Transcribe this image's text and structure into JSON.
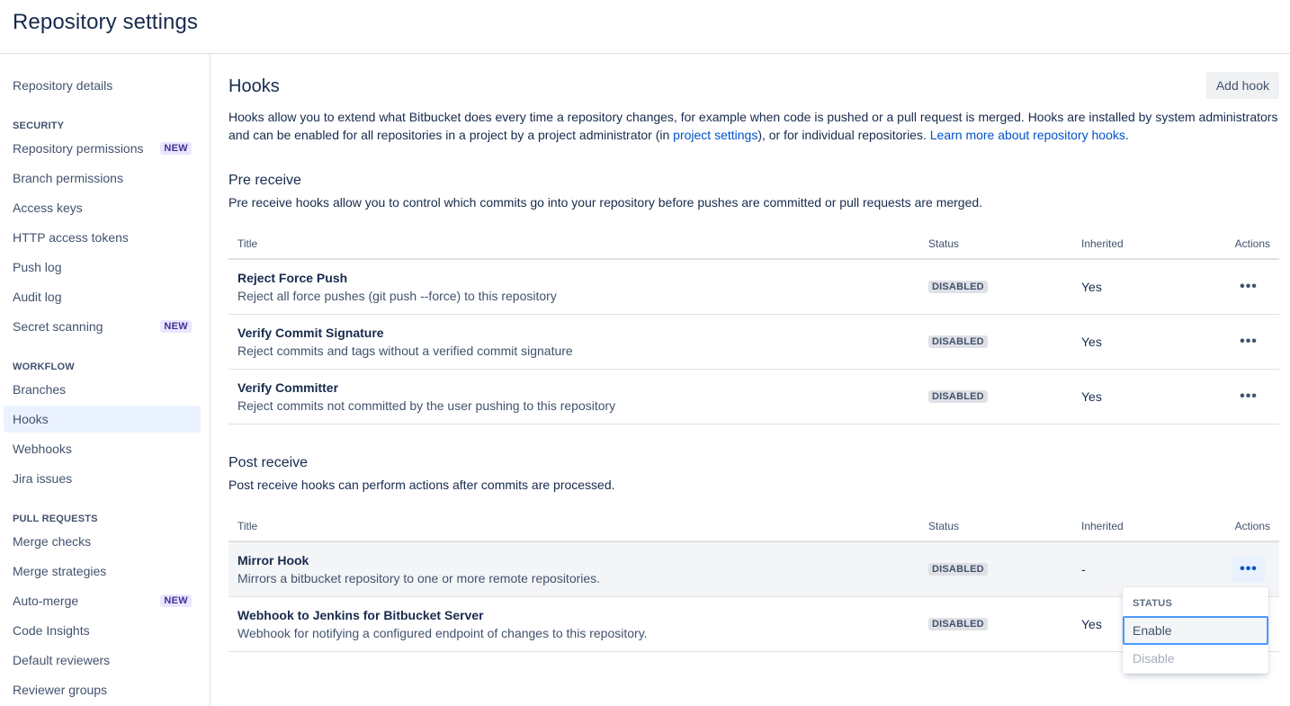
{
  "page": {
    "title": "Repository settings"
  },
  "sidebar": {
    "items": [
      {
        "label": "Repository details"
      },
      {
        "section": "SECURITY"
      },
      {
        "label": "Repository permissions",
        "badge": "NEW"
      },
      {
        "label": "Branch permissions"
      },
      {
        "label": "Access keys"
      },
      {
        "label": "HTTP access tokens"
      },
      {
        "label": "Push log"
      },
      {
        "label": "Audit log"
      },
      {
        "label": "Secret scanning",
        "badge": "NEW"
      },
      {
        "section": "WORKFLOW"
      },
      {
        "label": "Branches"
      },
      {
        "label": "Hooks",
        "active": true
      },
      {
        "label": "Webhooks"
      },
      {
        "label": "Jira issues"
      },
      {
        "section": "PULL REQUESTS"
      },
      {
        "label": "Merge checks"
      },
      {
        "label": "Merge strategies"
      },
      {
        "label": "Auto-merge",
        "badge": "NEW"
      },
      {
        "label": "Code Insights"
      },
      {
        "label": "Default reviewers"
      },
      {
        "label": "Reviewer groups"
      }
    ]
  },
  "main": {
    "title": "Hooks",
    "add_hook_label": "Add hook",
    "intro": {
      "text1": "Hooks allow you to extend what Bitbucket does every time a repository changes, for example when code is pushed or a pull request is merged. Hooks are installed by system administrators and can be enabled for all repositories in a project by a project administrator (in ",
      "link1": "project settings",
      "text2": "), or for individual repositories. ",
      "link2": "Learn more about repository hooks",
      "text3": "."
    },
    "columns": {
      "title": "Title",
      "status": "Status",
      "inherited": "Inherited",
      "actions": "Actions"
    },
    "pre_receive": {
      "title": "Pre receive",
      "description": "Pre receive hooks allow you to control which commits go into your repository before pushes are committed or pull requests are merged.",
      "hooks": [
        {
          "name": "Reject Force Push",
          "description": "Reject all force pushes (git push --force) to this repository",
          "status": "DISABLED",
          "inherited": "Yes"
        },
        {
          "name": "Verify Commit Signature",
          "description": "Reject commits and tags without a verified commit signature",
          "status": "DISABLED",
          "inherited": "Yes"
        },
        {
          "name": "Verify Committer",
          "description": "Reject commits not committed by the user pushing to this repository",
          "status": "DISABLED",
          "inherited": "Yes"
        }
      ]
    },
    "post_receive": {
      "title": "Post receive",
      "description": "Post receive hooks can perform actions after commits are processed.",
      "hooks": [
        {
          "name": "Mirror Hook",
          "description": "Mirrors a bitbucket repository to one or more remote repositories.",
          "status": "DISABLED",
          "inherited": "-"
        },
        {
          "name": "Webhook to Jenkins for Bitbucket Server",
          "description": "Webhook for notifying a configured endpoint of changes to this repository.",
          "status": "DISABLED",
          "inherited": "Yes"
        }
      ]
    },
    "actions_glyph": "•••"
  },
  "dropdown": {
    "heading": "STATUS",
    "enable_label": "Enable",
    "disable_label": "Disable"
  }
}
